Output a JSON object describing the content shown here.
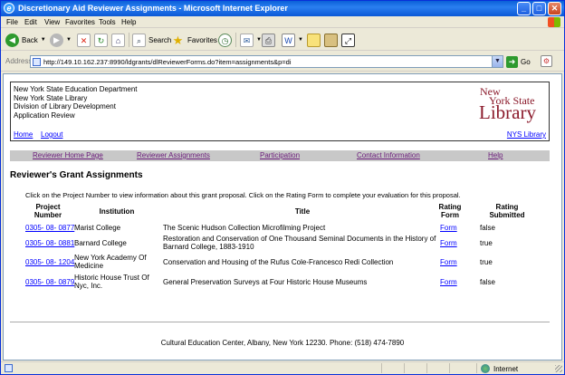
{
  "window": {
    "title": "Discretionary Aid Reviewer Assignments - Microsoft Internet Explorer",
    "minimize": "_",
    "maximize": "□",
    "close": "✕"
  },
  "menu": [
    "File",
    "Edit",
    "View",
    "Favorites",
    "Tools",
    "Help"
  ],
  "toolbar": {
    "back": "Back",
    "search": "Search",
    "favorites": "Favorites"
  },
  "address": {
    "label": "Address",
    "url": "http://149.10.162.237:8990/ldgrants/dlReviewerForms.do?item=assignments&p=di",
    "go": "Go"
  },
  "header": {
    "lines": [
      "New York State Education Department",
      "New York State Library",
      "Division of Library Development",
      "Application Review"
    ],
    "home_link": "Home",
    "logout_link": "Logout",
    "nys_link": "NYS Library",
    "logo": {
      "line1": "New",
      "line2": "York State",
      "line3": "Library"
    }
  },
  "nav": {
    "items": [
      "Reviewer Home Page",
      "Reviewer Assignments",
      "Participation",
      "Contact Information",
      "Help"
    ]
  },
  "page": {
    "heading": "Reviewer's Grant Assignments",
    "intro": "Click on the Project Number to view information about this grant proposal.  Click on the Rating Form to complete your evaluation for this proposal."
  },
  "table": {
    "headers": {
      "project_number_1": "Project",
      "project_number_2": "Number",
      "institution": "Institution",
      "title": "Title",
      "rating_form_1": "Rating",
      "rating_form_2": "Form",
      "rating_submitted_1": "Rating",
      "rating_submitted_2": "Submitted"
    },
    "rows": [
      {
        "project": "0305- 08- 0877",
        "institution_1": "Marist College",
        "institution_2": "",
        "title_1": "The Scenic Hudson Collection Microfilming Project",
        "title_2": "",
        "form": "Form",
        "submitted": "false"
      },
      {
        "project": "0305- 08- 0881",
        "institution_1": "Barnard College",
        "institution_2": "",
        "title_1": "Restoration and Conservation of One Thousand Seminal Documents in the History of",
        "title_2": "Barnard College, 1883-1910",
        "form": "Form",
        "submitted": "true"
      },
      {
        "project": "0305- 08- 1204",
        "institution_1": "New York Academy Of",
        "institution_2": "Medicine",
        "title_1": "Conservation and Housing of the Rufus Cole-Francesco Redi Collection",
        "title_2": "",
        "form": "Form",
        "submitted": "true"
      },
      {
        "project": "0305- 08- 0879",
        "institution_1": "Historic House Trust Of",
        "institution_2": "Nyc, Inc.",
        "title_1": "General Preservation Surveys at Four Historic House Museums",
        "title_2": "",
        "form": "Form",
        "submitted": "false"
      }
    ]
  },
  "footer": {
    "text": "Cultural Education Center, Albany, New York 12230. Phone: (518) 474-7890"
  },
  "status": {
    "zone": "Internet"
  }
}
